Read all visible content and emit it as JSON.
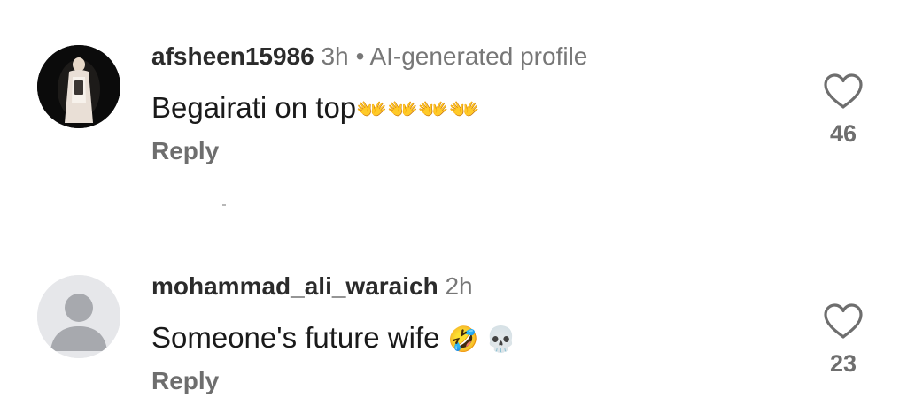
{
  "comments": [
    {
      "username": "afsheen15986",
      "time": "3h",
      "separator": "•",
      "badge": "AI-generated profile",
      "text": "Begairati  on top",
      "emojis": "👐👐👐👐",
      "reply_label": "Reply",
      "like_count": "46",
      "avatar": "photo"
    },
    {
      "username": "mohammad_ali_waraich",
      "time": "2h",
      "text": "Someone's future wife",
      "emojis": "🤣 💀",
      "reply_label": "Reply",
      "like_count": "23",
      "avatar": "default-person"
    }
  ],
  "colors": {
    "username": "#2b2b2b",
    "secondary": "#777777",
    "text": "#1a1a1a",
    "avatar_default_bg": "#e6e7ea",
    "avatar_default_fg": "#a7a9ae"
  },
  "icons": {
    "like": "heart-outline-icon",
    "avatar_placeholder": "person-silhouette-icon"
  }
}
